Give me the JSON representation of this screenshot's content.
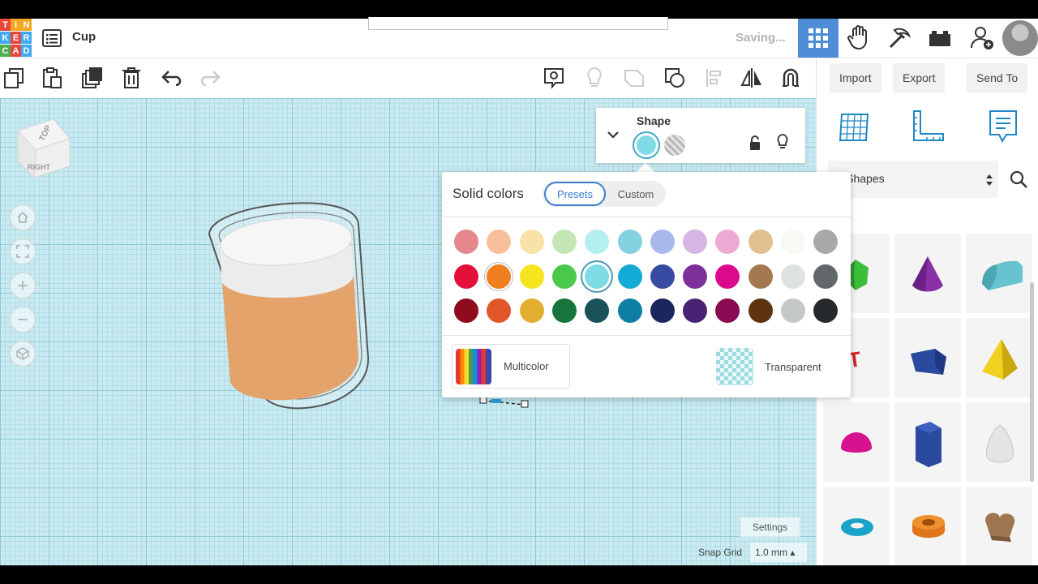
{
  "header": {
    "logo_letters": [
      "T",
      "I",
      "N",
      "K",
      "E",
      "R",
      "C",
      "A",
      "D"
    ],
    "logo_colors": [
      "#e8473c",
      "#f5a623",
      "#f5a623",
      "#3fa9f5",
      "#e8473c",
      "#3fa9f5",
      "#4caf50",
      "#e8473c",
      "#3fa9f5"
    ],
    "design_title": "Cup",
    "status": "Saving...",
    "nav_icons": [
      "grid-view-icon",
      "tinker-hand-icon",
      "build-pickaxe-icon",
      "bricks-icon",
      "add-user-icon",
      "avatar"
    ]
  },
  "toolbar": {
    "left_icons": [
      "copy-icon",
      "paste-icon",
      "duplicate-icon",
      "delete-icon",
      "undo-icon",
      "redo-icon"
    ],
    "right_icons": [
      "note-icon",
      "light-bulb-icon",
      "group-icon",
      "ungroup-icon",
      "align-icon",
      "mirror-icon",
      "magnet-icon"
    ],
    "import_label": "Import",
    "export_label": "Export",
    "send_to_label": "Send To"
  },
  "viewcube": {
    "top_label": "TOP",
    "right_label": "RIGHT"
  },
  "workplane": {
    "settings_label": "Settings",
    "snap_grid_label": "Snap Grid",
    "snap_grid_value": "1.0 mm ▴"
  },
  "inspector": {
    "title": "Shape",
    "solid_color": "#7fdce6"
  },
  "color_popup": {
    "title": "Solid colors",
    "presets_label": "Presets",
    "custom_label": "Custom",
    "multicolor_label": "Multicolor",
    "transparent_label": "Transparent",
    "selected_color": "#7fdce6",
    "rows": [
      [
        "#e5878c",
        "#f7c09a",
        "#f8e2a8",
        "#c4e6b4",
        "#b3eef0",
        "#84d2e1",
        "#a7b8eb",
        "#d4b5e4",
        "#eeaad2",
        "#e0bf90",
        "#f8f8f4",
        "#a7a9ab"
      ],
      [
        "#e3103a",
        "#f07f22",
        "#f8e41e",
        "#4bc94b",
        "#7fdce6",
        "#13aad6",
        "#364ba1",
        "#7c3098",
        "#db0a8c",
        "#a4794f",
        "#dfe2e2",
        "#62676a"
      ],
      [
        "#8f0b1e",
        "#e3562a",
        "#e1b032",
        "#17743a",
        "#1a525a",
        "#0f7ea5",
        "#1a265d",
        "#4a2274",
        "#8a0b51",
        "#5e3310",
        "#c4c8c8",
        "#272a2c"
      ]
    ]
  },
  "right_panel": {
    "view_icons": [
      "workplane-icon",
      "ruler-icon",
      "notes-icon"
    ],
    "shape_library_label": "Basic Shapes",
    "shape_tiles": [
      "green-gem-shape",
      "purple-cone-shape",
      "teal-half-cylinder-shape",
      "red-text-shape",
      "blue-polygon-shape",
      "yellow-pyramid-shape",
      "magenta-half-sphere-shape",
      "blue-hexagonal-prism-shape",
      "white-paraboloid-shape",
      "teal-torus-shape",
      "orange-tube-shape",
      "brown-heart-shape"
    ]
  }
}
